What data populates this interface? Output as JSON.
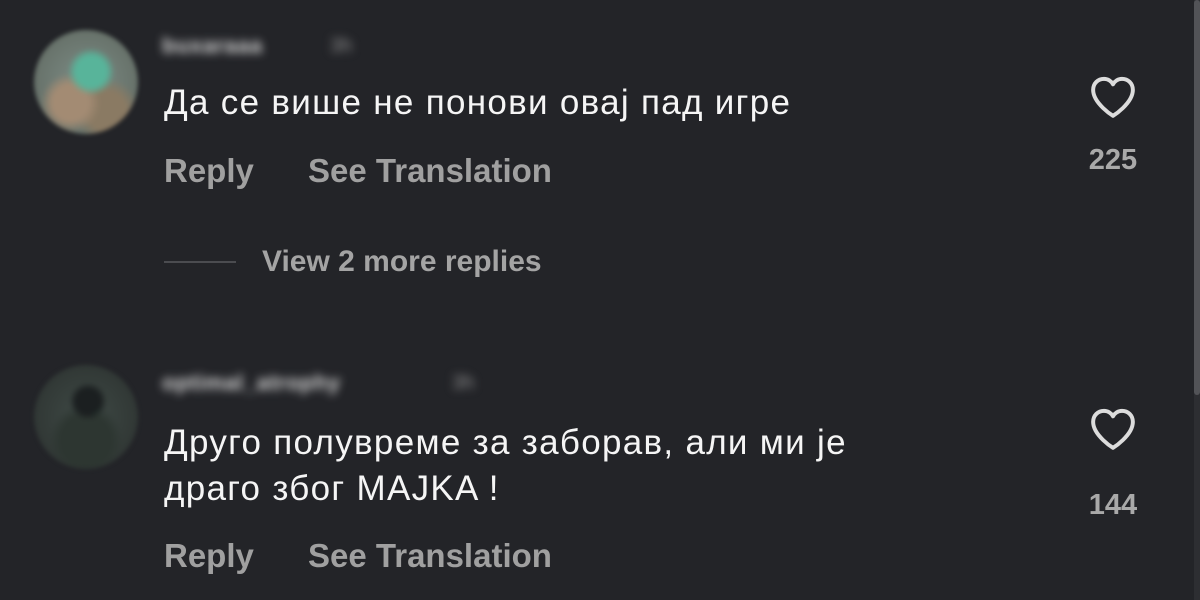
{
  "comments": [
    {
      "username": "buxaraaa",
      "time": "3h",
      "text": "Да се више не понови овај пад игре",
      "reply_label": "Reply",
      "translate_label": "See Translation",
      "likes": "225",
      "view_replies_label": "View 2 more replies"
    },
    {
      "username": "optimal_atrophy",
      "time": "3h",
      "text": "Друго полувреме за заборав, али ми је\nдраго због MAJKA !",
      "reply_label": "Reply",
      "translate_label": "See Translation",
      "likes": "144"
    }
  ],
  "icons": {
    "like": "heart-outline-icon"
  },
  "colors": {
    "background": "#232428",
    "primary_text": "#f5f5f5",
    "secondary_text": "#a0a0a0"
  }
}
